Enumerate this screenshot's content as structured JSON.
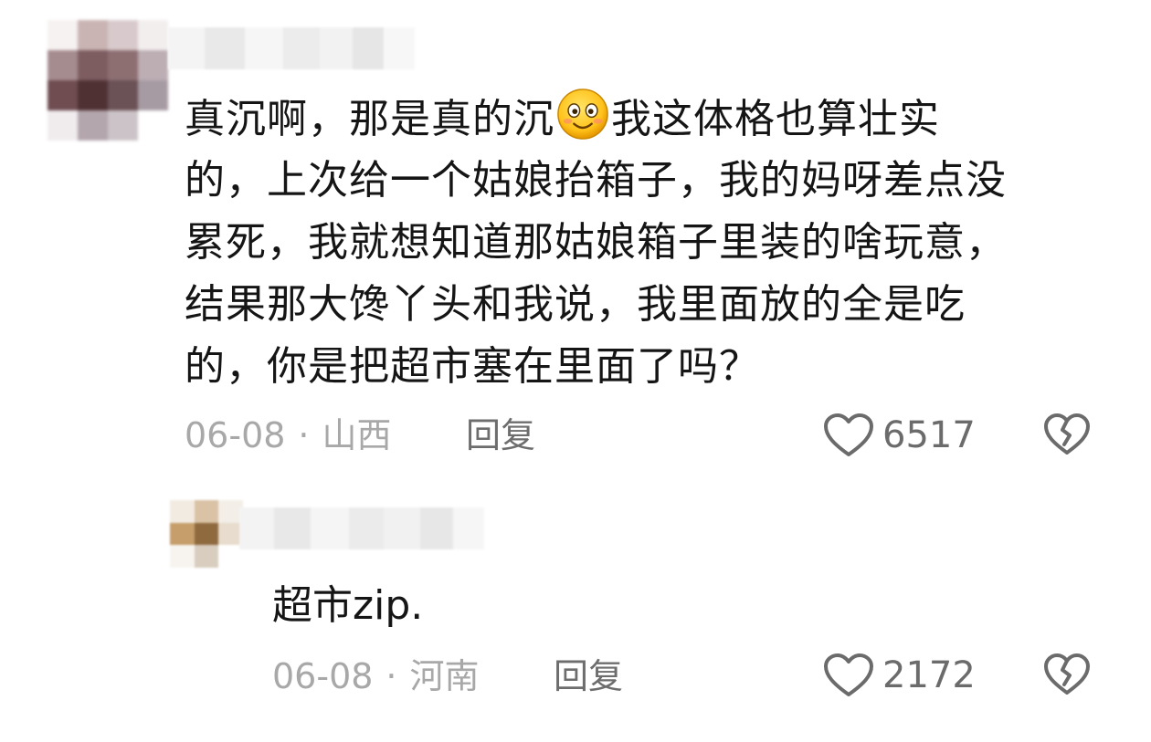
{
  "comments": [
    {
      "lines": [
        [
          "真沉啊，那是真的沉",
          "我这体格也算壮实"
        ],
        "的，上次给一个姑娘抬箱子，我的妈呀差点没",
        "累死，我就想知道那姑娘箱子里装的啥玩意，",
        "结果那大馋丫头和我说，我里面放的全是吃",
        "的，你是把超市塞在里面了吗？"
      ],
      "emoji_icon": "smiley-emoji-icon",
      "date": "06-08",
      "location": "山西",
      "reply_label": "回复",
      "likes": "6517"
    },
    {
      "text": "超市zip.",
      "date": "06-08",
      "location": "河南",
      "reply_label": "回复",
      "likes": "2172"
    }
  ],
  "separator": "·",
  "icons": {
    "like": "heart-outline-icon",
    "dislike": "broken-heart-icon"
  }
}
